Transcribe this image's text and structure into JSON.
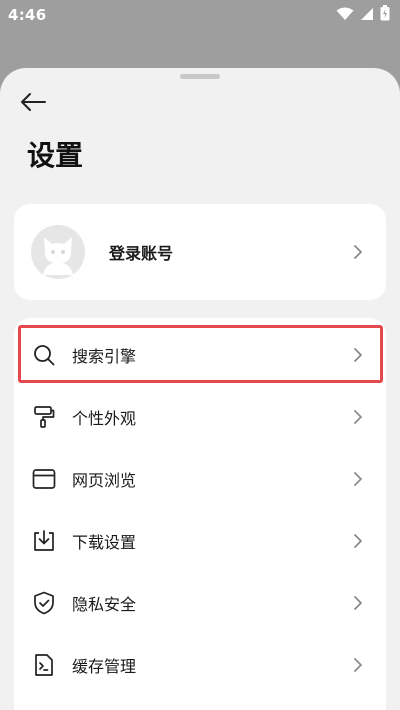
{
  "status_bar": {
    "time": "4:46"
  },
  "header": {
    "title": "设置"
  },
  "account": {
    "label": "登录账号"
  },
  "menu": {
    "items": [
      {
        "label": "搜索引擎",
        "icon": "search-icon"
      },
      {
        "label": "个性外观",
        "icon": "paint-roller-icon"
      },
      {
        "label": "网页浏览",
        "icon": "browser-window-icon"
      },
      {
        "label": "下载设置",
        "icon": "download-icon"
      },
      {
        "label": "隐私安全",
        "icon": "shield-check-icon"
      },
      {
        "label": "缓存管理",
        "icon": "terminal-file-icon"
      }
    ]
  },
  "colors": {
    "highlight": "#e5484d",
    "sheet": "#f1f1f1",
    "card": "#ffffff",
    "scrim": "#9e9e9e"
  }
}
